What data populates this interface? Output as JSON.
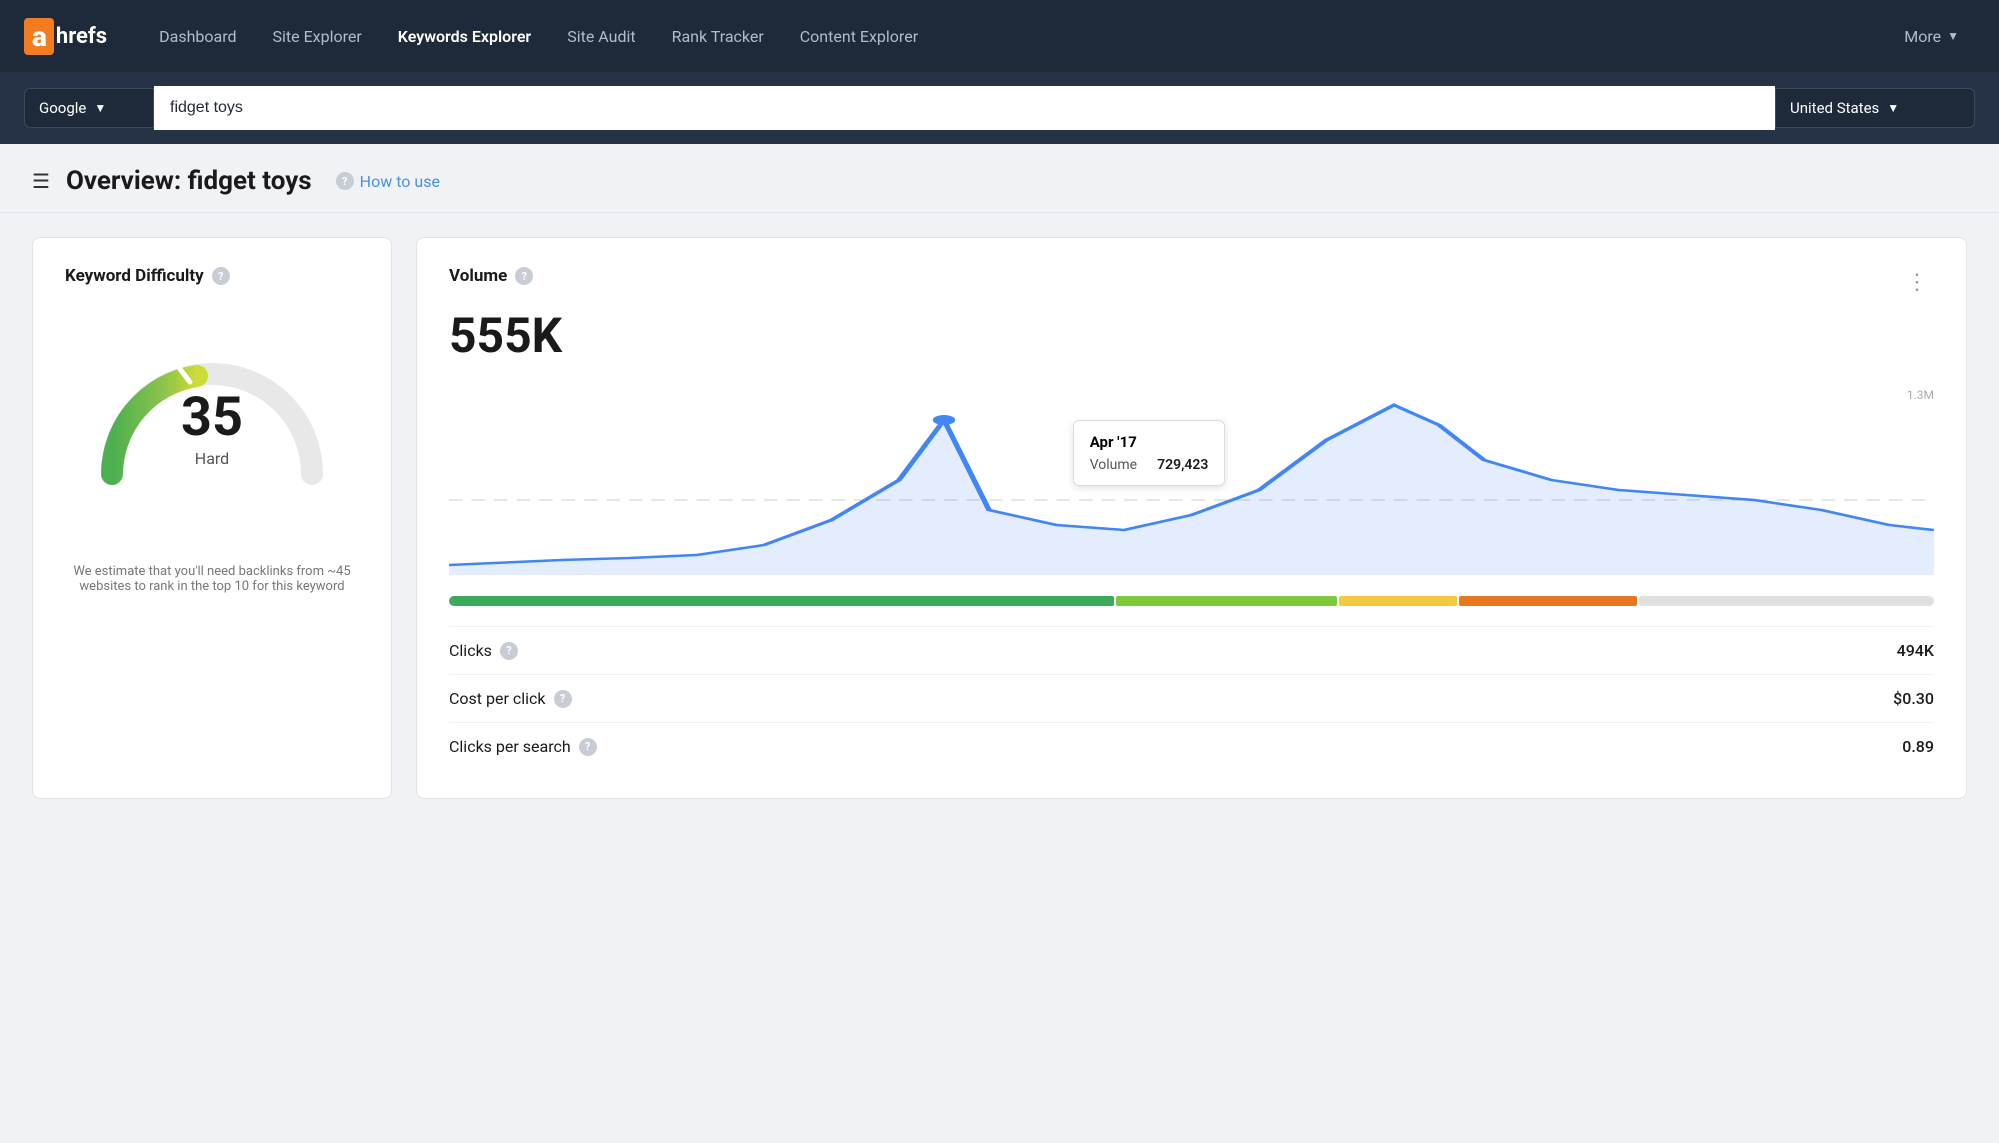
{
  "brand": {
    "logo_letter": "a",
    "logo_rest": "hrefs"
  },
  "nav": {
    "links": [
      {
        "id": "dashboard",
        "label": "Dashboard",
        "active": false
      },
      {
        "id": "site-explorer",
        "label": "Site Explorer",
        "active": false
      },
      {
        "id": "keywords-explorer",
        "label": "Keywords Explorer",
        "active": true
      },
      {
        "id": "site-audit",
        "label": "Site Audit",
        "active": false
      },
      {
        "id": "rank-tracker",
        "label": "Rank Tracker",
        "active": false
      },
      {
        "id": "content-explorer",
        "label": "Content Explorer",
        "active": false
      }
    ],
    "more_label": "More"
  },
  "search": {
    "engine": "Google",
    "query": "fidget toys",
    "country": "United States",
    "chevron": "▼"
  },
  "overview": {
    "title": "Overview: fidget toys",
    "how_to_use": "How to use"
  },
  "keyword_difficulty": {
    "title": "Keyword Difficulty",
    "score": "35",
    "label": "Hard",
    "description": "We estimate that you'll need backlinks from ~45 websites to rank in the top 10 for this keyword"
  },
  "volume": {
    "title": "Volume",
    "value": "555K",
    "y_axis_label": "1.3M",
    "tooltip": {
      "date": "Apr '17",
      "label": "Volume",
      "value": "729,423"
    },
    "color_bar": [
      {
        "color": "#3daa5a",
        "width": 45
      },
      {
        "color": "#7ec83e",
        "width": 15
      },
      {
        "color": "#f5c842",
        "width": 8
      },
      {
        "color": "#e87722",
        "width": 12
      },
      {
        "color": "#e0e0e0",
        "width": 20
      }
    ],
    "metrics": [
      {
        "id": "clicks",
        "label": "Clicks",
        "value": "494K"
      },
      {
        "id": "cost-per-click",
        "label": "Cost per click",
        "value": "$0.30"
      },
      {
        "id": "clicks-per-search",
        "label": "Clicks per search",
        "value": "0.89"
      }
    ],
    "more_options": "⋮"
  }
}
